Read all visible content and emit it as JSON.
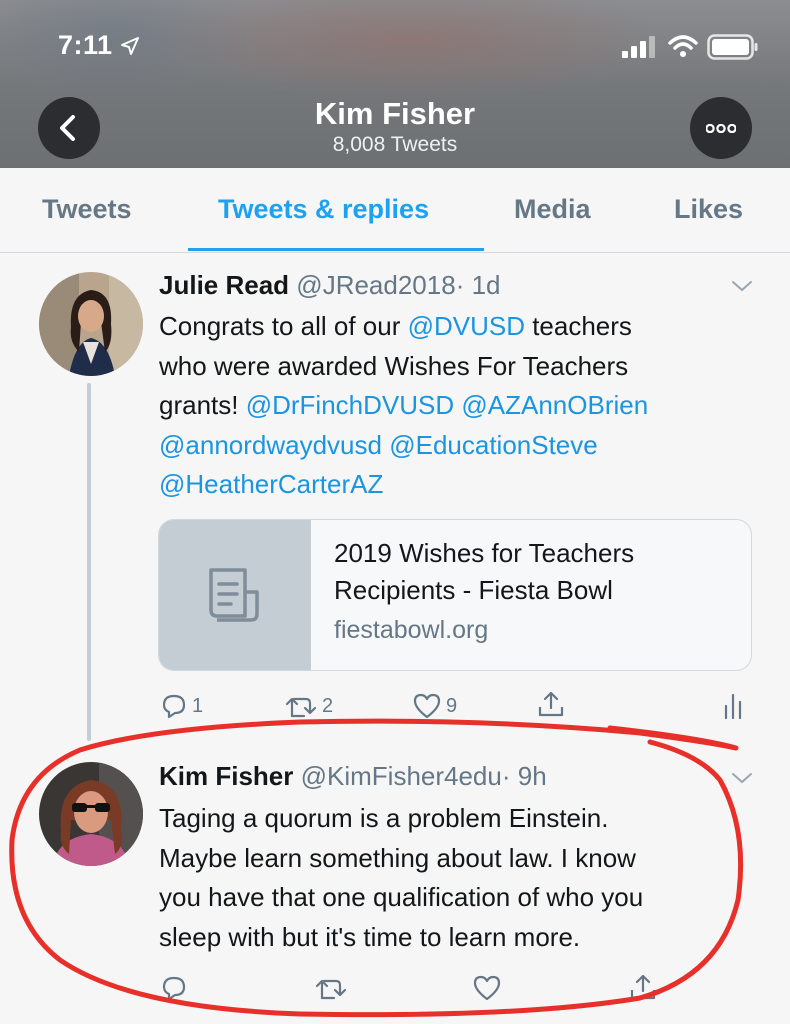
{
  "status_bar": {
    "time": "7:11"
  },
  "header": {
    "title": "Kim Fisher",
    "subtitle": "8,008 Tweets"
  },
  "tabs": [
    {
      "label": "Tweets",
      "active": false
    },
    {
      "label": "Tweets & replies",
      "active": true
    },
    {
      "label": "Media",
      "active": false
    },
    {
      "label": "Likes",
      "active": false
    }
  ],
  "tweets": [
    {
      "name": "Julie Read",
      "handle": "@JRead2018",
      "time": "· 1d",
      "body": {
        "l1_a": "Congrats to all of our ",
        "l1_mention": "@DVUSD",
        "l1_b": " teachers",
        "l2": "who were awarded Wishes For Teachers",
        "l3_a": "grants! ",
        "l3_m1": "@DrFinchDVUSD",
        "l3_m2": "@AZAnnOBrien",
        "l4_m1": "@annordwaydvusd",
        "l4_m2": "@EducationSteve",
        "l5_m1": "@HeatherCarterAZ"
      },
      "card": {
        "title": "2019 Wishes for Teachers Recipients - Fiesta Bowl",
        "domain": "fiestabowl.org",
        "icon": "document-icon"
      },
      "actions": {
        "replies": "1",
        "retweets": "2",
        "likes": "9"
      }
    },
    {
      "name": "Kim Fisher",
      "handle": "@KimFisher4edu",
      "time": "· 9h",
      "body_lines": [
        "Taging a quorum is a problem Einstein.",
        "Maybe learn something about law. I know",
        "you have that one qualification of who you",
        "sleep with but it's time to learn more."
      ]
    }
  ],
  "colors": {
    "accent": "#1da1f2",
    "mention": "#1b95e0",
    "muted": "#657786",
    "annotation": "#e8302a"
  }
}
